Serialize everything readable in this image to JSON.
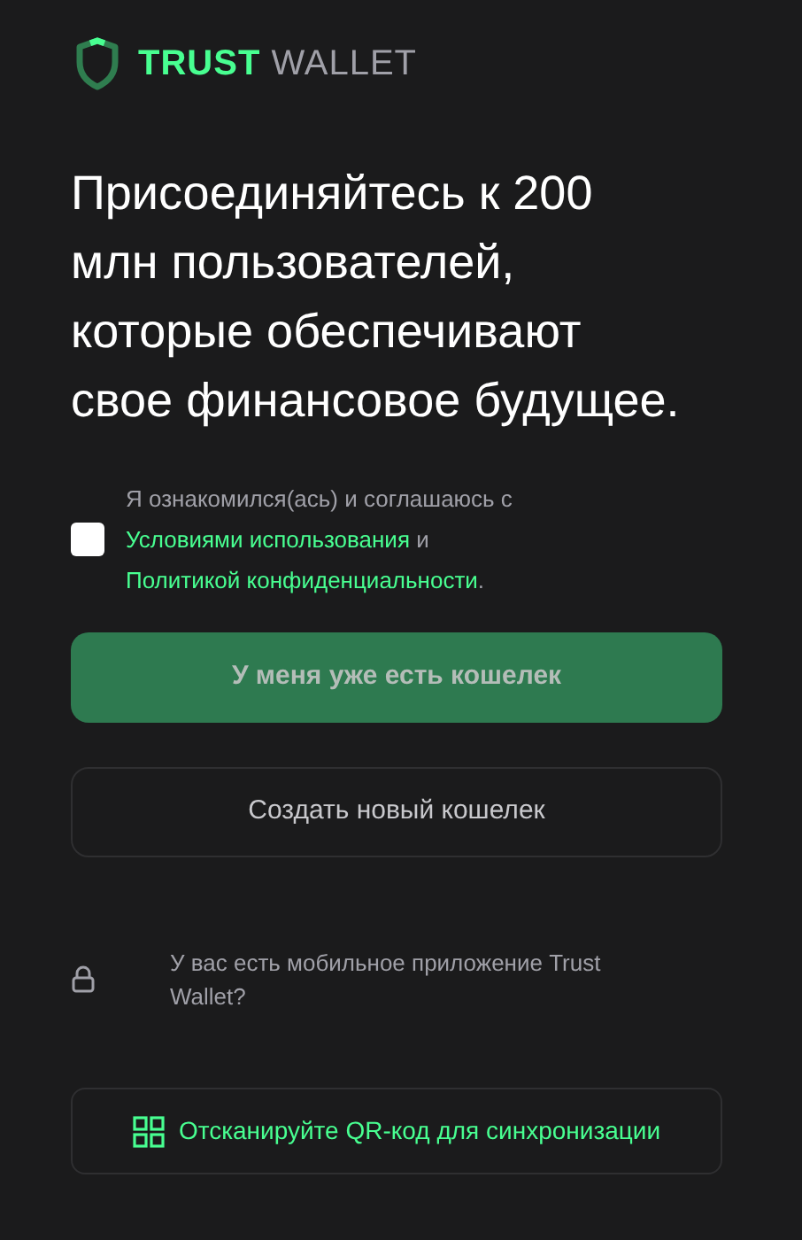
{
  "logo": {
    "brand": "TRUST",
    "product": "WALLET"
  },
  "headline": "Присоединяйтесь к 200 млн пользователей, которые обеспечивают свое финансовое будущее.",
  "consent": {
    "checked": false,
    "parts": [
      {
        "kind": "text",
        "text": "Я ознакомился(ась) и соглашаюсь с "
      },
      {
        "kind": "link",
        "text": "Условиями использования"
      },
      {
        "kind": "text",
        "text": " и "
      },
      {
        "kind": "link",
        "text": "Политикой конфиденциальности"
      },
      {
        "kind": "text",
        "text": "."
      }
    ]
  },
  "buttons": [
    {
      "label": "У меня уже есть кошелек",
      "kind": "primary",
      "disabled": true
    },
    {
      "label": "Создать новый кошелек",
      "kind": "secondary",
      "disabled": false
    }
  ],
  "mobile": {
    "text": "У вас есть мобильное приложение Trust Wallet?",
    "button": "Отсканируйте QR-код для синхронизации"
  }
}
